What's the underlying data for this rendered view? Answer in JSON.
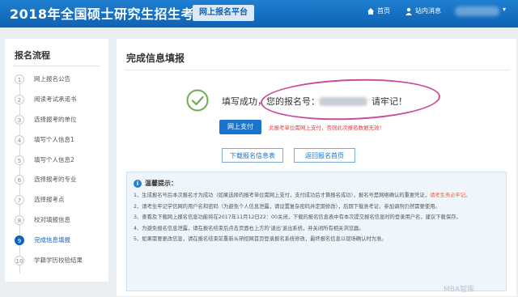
{
  "header": {
    "site_title": "2018年全国硕士研究生招生考试",
    "platform": "网上报名平台",
    "home": "首页",
    "messages": "站内消息"
  },
  "sidebar": {
    "title": "报名流程",
    "steps": [
      {
        "num": "1",
        "label": "网上报名公告"
      },
      {
        "num": "2",
        "label": "阅读考试承诺书"
      },
      {
        "num": "3",
        "label": "选择报考的单位"
      },
      {
        "num": "4",
        "label": "填写个人信息1"
      },
      {
        "num": "5",
        "label": "填写个人信息2"
      },
      {
        "num": "6",
        "label": "选择报考的专业"
      },
      {
        "num": "7",
        "label": "选择报考点"
      },
      {
        "num": "8",
        "label": "校对填报信息"
      },
      {
        "num": "9",
        "label": "完成信息填报"
      },
      {
        "num": "10",
        "label": "学籍学历校验结果"
      }
    ]
  },
  "main": {
    "title": "完成信息填报",
    "success_prefix": "填写成功，您的报名号：",
    "success_suffix": "请牢记！",
    "pay_button": "网上支付",
    "pay_note": "此报考单位需网上支付，否则此次报名数据无效！",
    "download_button": "下载报名信息表",
    "back_button": "返回报名首页",
    "tips_title": "温馨提示：",
    "tips": [
      {
        "text": "1、生成报名号后本次报名才为成功（如果选择的报考单位需网上支付，支付成功后才算报名成功），报名号是网络确认的重要凭证，",
        "highlight": "请考生务必牢记。"
      },
      {
        "text": "2、请考生牢记学信网的用户名和密码（为避免个人信息泄露，请设置复杂密码并定期修改），后期下载准考证、参加调剂仍然需要使用。",
        "highlight": ""
      },
      {
        "text": "3、查看及下载网上报名信息功能将在2017年11月12日22：00关闭，下载的报名信息表中有本次提交报名信息时的登录用户名，建议下载保存。",
        "highlight": ""
      },
      {
        "text": "4、为避免报名信息泄露，请在报名结束后点击页面右上方的'退出'退出系统，并关闭所有相关浏览器。",
        "highlight": ""
      },
      {
        "text": "5、如果需要更改信息，请在报名结束前重新从研招网首页登录报名系统修改，最终报名信息以现场确认时为准。",
        "highlight": ""
      }
    ]
  },
  "watermark": "MBA智库",
  "colors": {
    "accent": "#0e62b3",
    "highlight": "#c84b9e",
    "warning": "#e23c3c"
  }
}
